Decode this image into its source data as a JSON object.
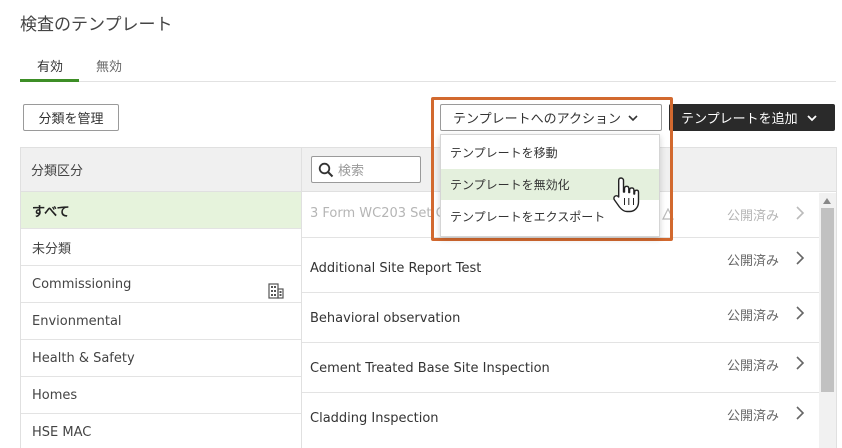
{
  "page": {
    "title": "検査のテンプレート"
  },
  "tabs": [
    {
      "label": "有効",
      "active": true
    },
    {
      "label": "無効",
      "active": false
    }
  ],
  "toolbar": {
    "manage_label": "分類を管理",
    "actions_label": "テンプレートへのアクション",
    "add_label": "テンプレートを追加"
  },
  "categories": {
    "header": "分類区分",
    "items": [
      {
        "label": "すべて",
        "selected": true
      },
      {
        "label": "未分類"
      },
      {
        "label": "Commissioning",
        "icon": "building-icon"
      },
      {
        "label": "Envionmental"
      },
      {
        "label": "Health & Safety"
      },
      {
        "label": "Homes"
      },
      {
        "label": "HSE MAC"
      }
    ]
  },
  "search": {
    "placeholder": "検索"
  },
  "templates": [
    {
      "name": "3 Form WC203 Set Ch",
      "status": "公開済み",
      "faded": true,
      "warning": true
    },
    {
      "name": "Additional Site Report Test",
      "status": "公開済み"
    },
    {
      "name": "Behavioral observation",
      "status": "公開済み"
    },
    {
      "name": "Cement Treated Base Site Inspection",
      "status": "公開済み"
    },
    {
      "name": "Cladding Inspection",
      "status": "公開済み"
    }
  ],
  "actions_menu": {
    "items": [
      {
        "label": "テンプレートを移動"
      },
      {
        "label": "テンプレートを無効化",
        "hovered": true
      },
      {
        "label": "テンプレートをエクスポート"
      }
    ]
  },
  "colors": {
    "accent_green": "#3d8e26",
    "highlight_orange": "#d2692f",
    "selected_bg": "#e6f3dc",
    "dark_button": "#2a2a2a"
  }
}
